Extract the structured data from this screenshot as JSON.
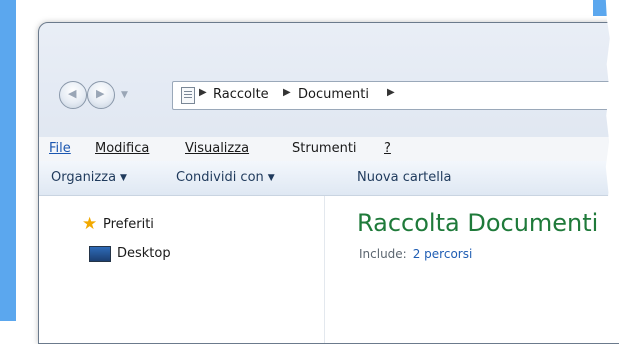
{
  "address": {
    "crumbs": [
      "Raccolte",
      "Documenti"
    ]
  },
  "menu": {
    "file": "File",
    "edit": "Modifica",
    "view": "Visualizza",
    "tools": "Strumenti",
    "help": "?"
  },
  "toolbar": {
    "organize": "Organizza",
    "share": "Condividi con",
    "new_folder": "Nuova cartella"
  },
  "nav": {
    "favorites": "Preferiti",
    "desktop": "Desktop"
  },
  "library": {
    "title": "Raccolta Documenti",
    "include_label": "Include:",
    "include_link": "2 percorsi"
  }
}
